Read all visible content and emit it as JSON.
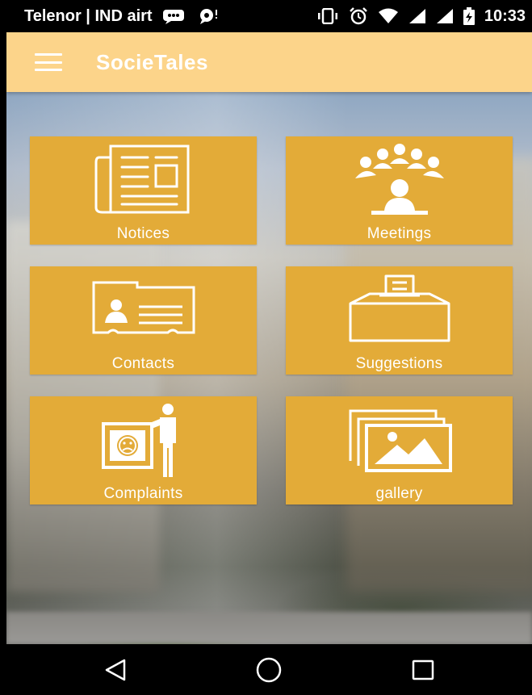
{
  "status_bar": {
    "carrier": "Telenor | IND airt",
    "time": "10:33",
    "icons": [
      "message-icon",
      "chat-icon",
      "vibrate-icon",
      "alarm-icon",
      "wifi-icon",
      "signal-icon",
      "signal-icon",
      "battery-charging-icon"
    ]
  },
  "app_bar": {
    "title": "SocieTales",
    "menu_icon": "hamburger-menu-icon"
  },
  "tiles": [
    {
      "label": "Notices",
      "icon": "newspaper-icon"
    },
    {
      "label": "Meetings",
      "icon": "meeting-icon"
    },
    {
      "label": "Contacts",
      "icon": "contact-card-icon"
    },
    {
      "label": "Suggestions",
      "icon": "suggestion-box-icon"
    },
    {
      "label": "Complaints",
      "icon": "complaint-icon"
    },
    {
      "label": "gallery",
      "icon": "gallery-icon"
    }
  ],
  "nav_bar": {
    "icons": [
      "back-icon",
      "home-icon",
      "recents-icon"
    ]
  },
  "colors": {
    "app_bar": "#fcd48a",
    "tile": "#e3ab38",
    "text": "#ffffff"
  }
}
